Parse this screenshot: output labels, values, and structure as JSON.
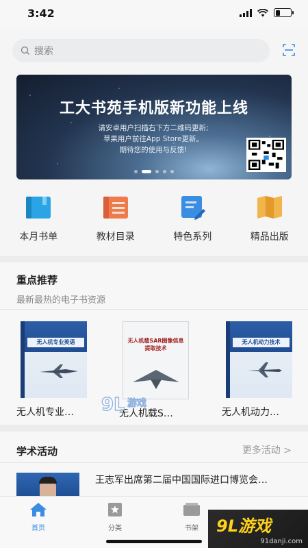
{
  "status_bar": {
    "time": "3:42"
  },
  "search": {
    "placeholder": "搜索"
  },
  "banner": {
    "title": "工大书苑手机版新功能上线",
    "lines": [
      "请安卓用户扫描右下方二维码更新;",
      "苹果用户前往App Store更新。",
      "期待您的使用与反馈!"
    ]
  },
  "categories": [
    {
      "label": "本月书单",
      "icon": "book-icon",
      "color": "#2aa4e4"
    },
    {
      "label": "教材目录",
      "icon": "catalog-list-icon",
      "color": "#ef7a4b"
    },
    {
      "label": "特色系列",
      "icon": "notebook-pen-icon",
      "color": "#3a8de0"
    },
    {
      "label": "精品出版",
      "icon": "map-book-icon",
      "color": "#f2b44c"
    }
  ],
  "featured": {
    "title": "重点推荐",
    "subtitle": "最新最热的电子书资源",
    "books": [
      {
        "title": "无人机专业…",
        "cover_text": "无人机专业英语"
      },
      {
        "title": "无人机载S…",
        "cover_text": "无人机载SAR图像信息提取技术"
      },
      {
        "title": "无人机动力…",
        "cover_text": "无人机动力技术"
      }
    ]
  },
  "activities": {
    "title": "学术活动",
    "more": "更多活动 >",
    "items": [
      {
        "title": "王志军出席第二届中国国际进口博览会…"
      }
    ]
  },
  "tabbar": {
    "items": [
      {
        "label": "首页",
        "icon": "home-icon",
        "active": true
      },
      {
        "label": "分类",
        "icon": "bookmark-star-icon",
        "active": false
      },
      {
        "label": "书架",
        "icon": "bookshelf-icon",
        "active": false
      }
    ]
  },
  "watermark": {
    "logo": "9L游戏",
    "domain": "91danji.com"
  },
  "colors": {
    "accent": "#3a8de0",
    "background": "#f5f5f5"
  }
}
